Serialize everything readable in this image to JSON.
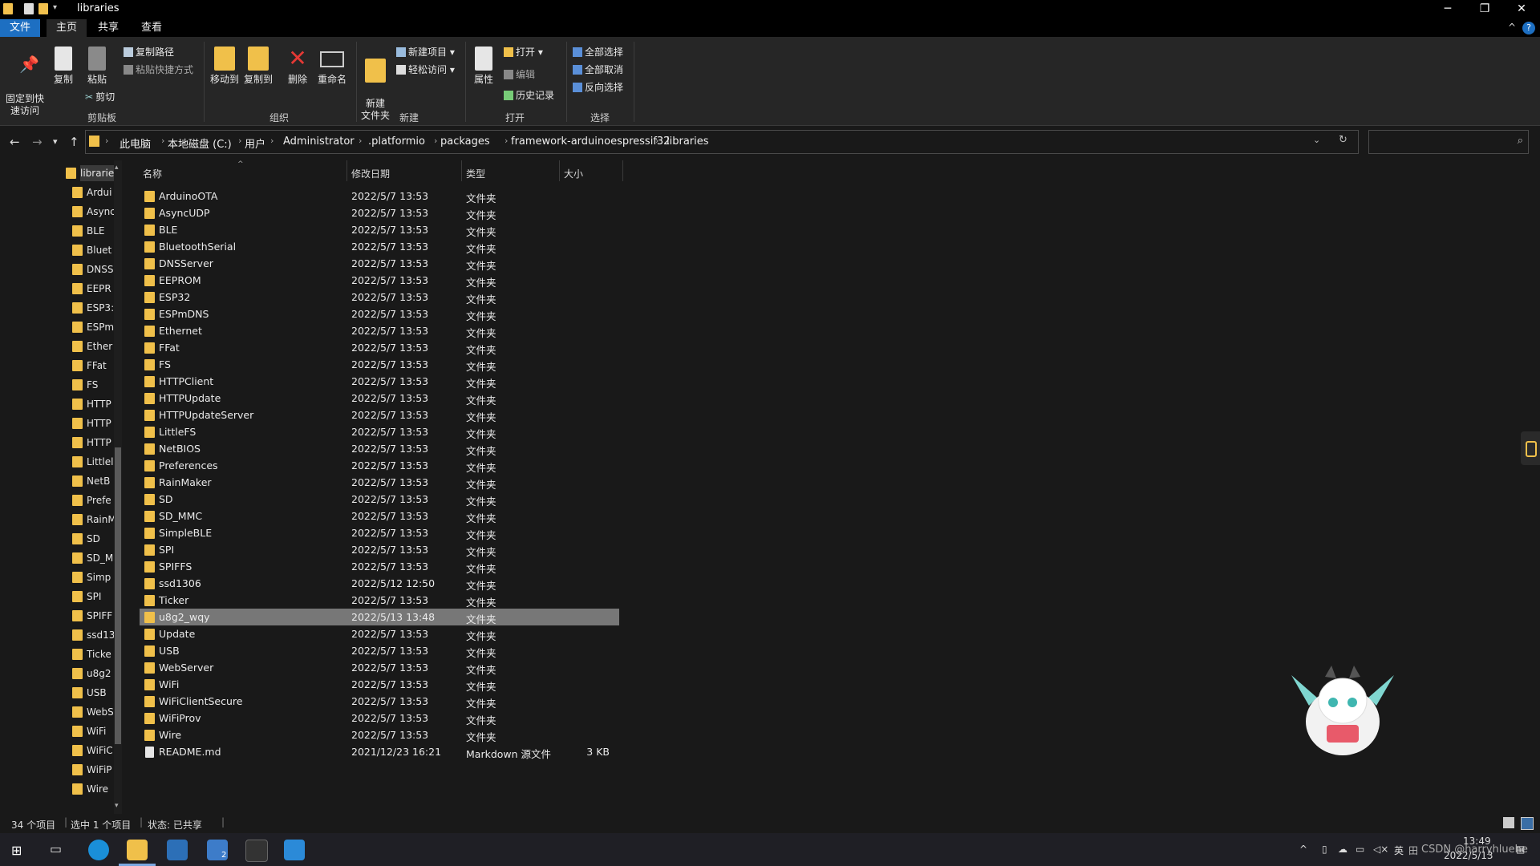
{
  "window": {
    "title": "libraries",
    "controls": {
      "minimize": "─",
      "maximize": "❐",
      "close": "✕"
    },
    "help": "?",
    "collapse": "^"
  },
  "ribbon_tabs": [
    "文件",
    "主页",
    "共享",
    "查看"
  ],
  "ribbon": {
    "clipboard": {
      "pin": "固定到快\n速访问",
      "copy": "复制",
      "paste": "粘贴",
      "copy_path": "复制路径",
      "paste_shortcut": "粘贴快捷方式",
      "cut": "剪切",
      "group": "剪贴板"
    },
    "organize": {
      "move_to": "移动到",
      "copy_to": "复制到",
      "delete": "删除",
      "rename": "重命名",
      "group": "组织"
    },
    "new": {
      "new_folder": "新建\n文件夹",
      "new_item": "新建项目",
      "easy_access": "轻松访问",
      "group": "新建"
    },
    "open": {
      "properties": "属性",
      "open": "打开",
      "edit": "编辑",
      "history": "历史记录",
      "group": "打开"
    },
    "select": {
      "select_all": "全部选择",
      "select_none": "全部取消",
      "invert": "反向选择",
      "group": "选择"
    }
  },
  "address": {
    "breadcrumbs": [
      "此电脑",
      "本地磁盘 (C:)",
      "用户",
      "Administrator",
      ".platformio",
      "packages",
      "framework-arduinoespressif32",
      "libraries"
    ],
    "search_placeholder": ""
  },
  "nav_pane": {
    "items": [
      "librarie",
      "Ardui",
      "Async",
      "BLE",
      "Bluet",
      "DNSS",
      "EEPR",
      "ESP3:",
      "ESPm",
      "Ether",
      "FFat",
      "FS",
      "HTTP",
      "HTTP",
      "HTTP",
      "Littlel",
      "NetB",
      "Prefe",
      "RainM",
      "SD",
      "SD_M",
      "Simp",
      "SPI",
      "SPIFF",
      "ssd13",
      "Ticke",
      "u8g2",
      "USB",
      "WebS",
      "WiFi",
      "WiFiC",
      "WiFiP",
      "Wire"
    ]
  },
  "columns": {
    "name": "名称",
    "date": "修改日期",
    "type": "类型",
    "size": "大小"
  },
  "files": [
    {
      "name": "ArduinoOTA",
      "date": "2022/5/7 13:53",
      "type": "文件夹",
      "size": ""
    },
    {
      "name": "AsyncUDP",
      "date": "2022/5/7 13:53",
      "type": "文件夹",
      "size": ""
    },
    {
      "name": "BLE",
      "date": "2022/5/7 13:53",
      "type": "文件夹",
      "size": ""
    },
    {
      "name": "BluetoothSerial",
      "date": "2022/5/7 13:53",
      "type": "文件夹",
      "size": ""
    },
    {
      "name": "DNSServer",
      "date": "2022/5/7 13:53",
      "type": "文件夹",
      "size": ""
    },
    {
      "name": "EEPROM",
      "date": "2022/5/7 13:53",
      "type": "文件夹",
      "size": ""
    },
    {
      "name": "ESP32",
      "date": "2022/5/7 13:53",
      "type": "文件夹",
      "size": ""
    },
    {
      "name": "ESPmDNS",
      "date": "2022/5/7 13:53",
      "type": "文件夹",
      "size": ""
    },
    {
      "name": "Ethernet",
      "date": "2022/5/7 13:53",
      "type": "文件夹",
      "size": ""
    },
    {
      "name": "FFat",
      "date": "2022/5/7 13:53",
      "type": "文件夹",
      "size": ""
    },
    {
      "name": "FS",
      "date": "2022/5/7 13:53",
      "type": "文件夹",
      "size": ""
    },
    {
      "name": "HTTPClient",
      "date": "2022/5/7 13:53",
      "type": "文件夹",
      "size": ""
    },
    {
      "name": "HTTPUpdate",
      "date": "2022/5/7 13:53",
      "type": "文件夹",
      "size": ""
    },
    {
      "name": "HTTPUpdateServer",
      "date": "2022/5/7 13:53",
      "type": "文件夹",
      "size": ""
    },
    {
      "name": "LittleFS",
      "date": "2022/5/7 13:53",
      "type": "文件夹",
      "size": ""
    },
    {
      "name": "NetBIOS",
      "date": "2022/5/7 13:53",
      "type": "文件夹",
      "size": ""
    },
    {
      "name": "Preferences",
      "date": "2022/5/7 13:53",
      "type": "文件夹",
      "size": ""
    },
    {
      "name": "RainMaker",
      "date": "2022/5/7 13:53",
      "type": "文件夹",
      "size": ""
    },
    {
      "name": "SD",
      "date": "2022/5/7 13:53",
      "type": "文件夹",
      "size": ""
    },
    {
      "name": "SD_MMC",
      "date": "2022/5/7 13:53",
      "type": "文件夹",
      "size": ""
    },
    {
      "name": "SimpleBLE",
      "date": "2022/5/7 13:53",
      "type": "文件夹",
      "size": ""
    },
    {
      "name": "SPI",
      "date": "2022/5/7 13:53",
      "type": "文件夹",
      "size": ""
    },
    {
      "name": "SPIFFS",
      "date": "2022/5/7 13:53",
      "type": "文件夹",
      "size": ""
    },
    {
      "name": "ssd1306",
      "date": "2022/5/12 12:50",
      "type": "文件夹",
      "size": ""
    },
    {
      "name": "Ticker",
      "date": "2022/5/7 13:53",
      "type": "文件夹",
      "size": ""
    },
    {
      "name": "u8g2_wqy",
      "date": "2022/5/13 13:48",
      "type": "文件夹",
      "size": "",
      "selected": true
    },
    {
      "name": "Update",
      "date": "2022/5/7 13:53",
      "type": "文件夹",
      "size": ""
    },
    {
      "name": "USB",
      "date": "2022/5/7 13:53",
      "type": "文件夹",
      "size": ""
    },
    {
      "name": "WebServer",
      "date": "2022/5/7 13:53",
      "type": "文件夹",
      "size": ""
    },
    {
      "name": "WiFi",
      "date": "2022/5/7 13:53",
      "type": "文件夹",
      "size": ""
    },
    {
      "name": "WiFiClientSecure",
      "date": "2022/5/7 13:53",
      "type": "文件夹",
      "size": ""
    },
    {
      "name": "WiFiProv",
      "date": "2022/5/7 13:53",
      "type": "文件夹",
      "size": ""
    },
    {
      "name": "Wire",
      "date": "2022/5/7 13:53",
      "type": "文件夹",
      "size": ""
    },
    {
      "name": "README.md",
      "date": "2021/12/23 16:21",
      "type": "Markdown 源文件",
      "size": "3 KB",
      "file": true
    }
  ],
  "status": {
    "count": "34 个项目",
    "selected": "选中 1 个项目",
    "state": "状态: 已共享"
  },
  "taskbar": {
    "time": "13:49",
    "date": "2022/5/13",
    "ime": "英",
    "watermark": "CSDN @harryhluehe",
    "mail_badge": "2"
  },
  "colors": {
    "accent": "#1d6fc2",
    "folder": "#f0c04a",
    "selected_row": "#777777",
    "background": "#191919"
  }
}
